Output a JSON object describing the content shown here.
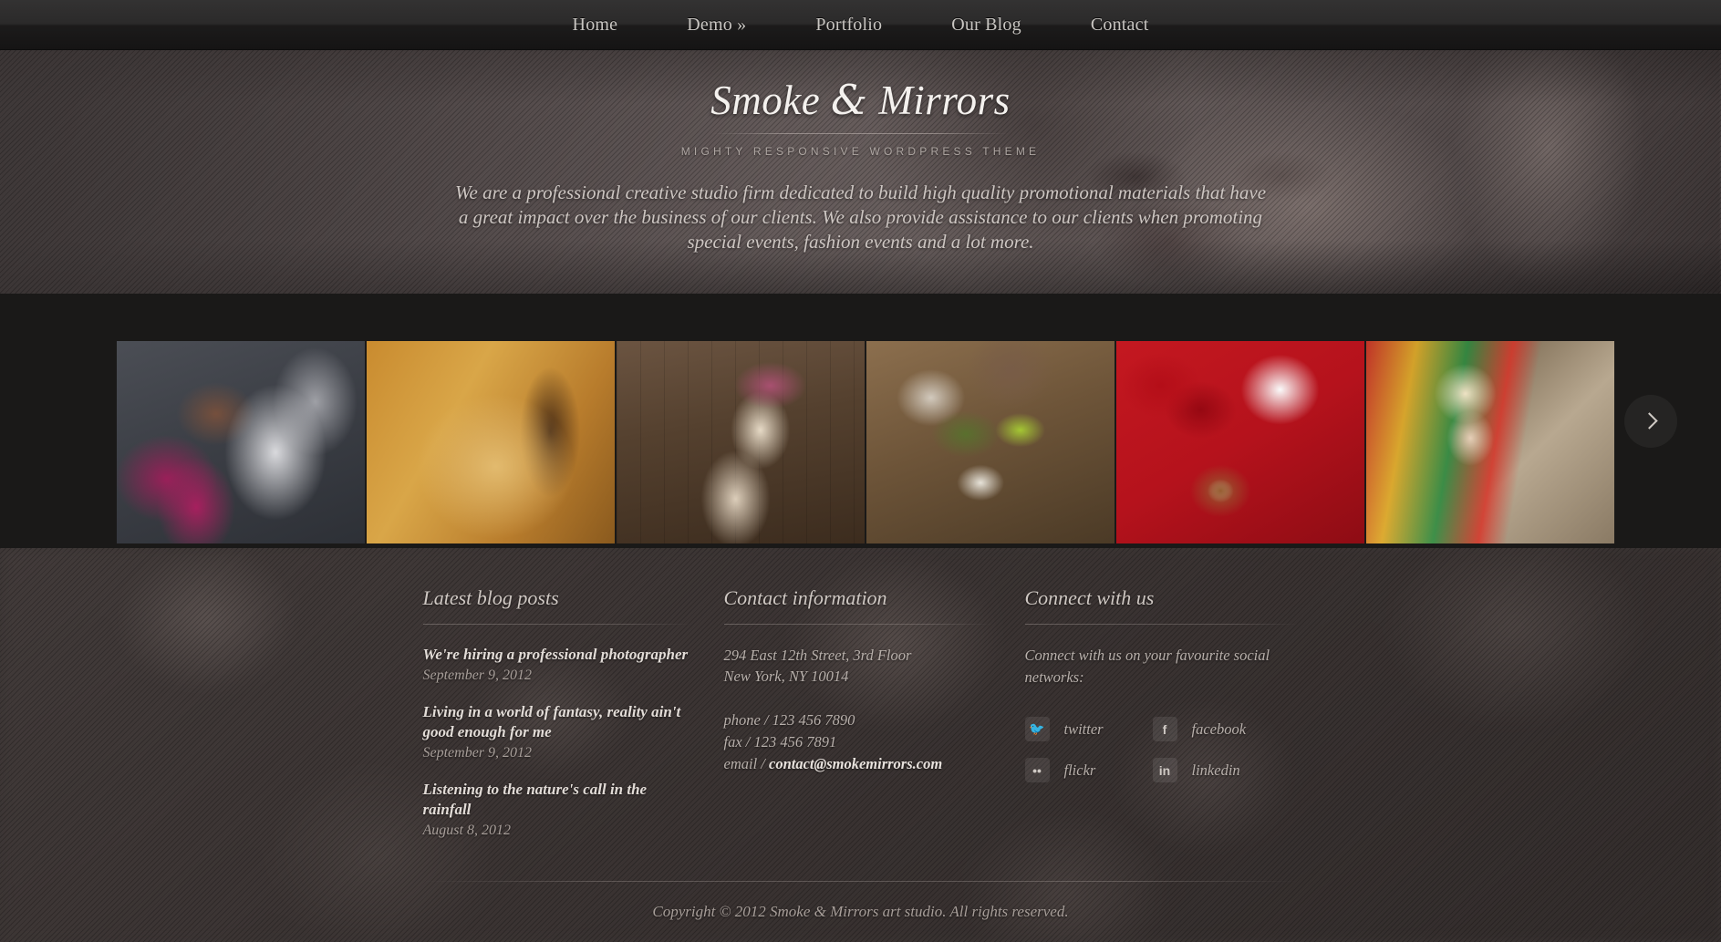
{
  "nav": {
    "items": [
      {
        "label": "Home",
        "name": "home"
      },
      {
        "label": "Demo »",
        "name": "demo"
      },
      {
        "label": "Portfolio",
        "name": "portfolio"
      },
      {
        "label": "Our Blog",
        "name": "blog"
      },
      {
        "label": "Contact",
        "name": "contact"
      }
    ]
  },
  "hero": {
    "title_part1": "Smoke ",
    "title_amp": "&",
    "title_part2": " Mirrors",
    "subtitle": "MIGHTY RESPONSIVE WORDPRESS THEME",
    "paragraph": "We are a professional creative studio firm dedicated to build high quality promotional materials that have a great impact over the business of our clients. We also provide assistance to our clients when promoting special events, fashion events and a lot more."
  },
  "gallery": {
    "next_label": "›",
    "items": [
      {
        "alt": "woman in magenta top with smoke",
        "class": "t1"
      },
      {
        "alt": "golden sundial close-up",
        "class": "t2"
      },
      {
        "alt": "blonde woman with pink hat and sunglasses on wood",
        "class": "t3"
      },
      {
        "alt": "spa still life with green bath salt",
        "class": "t4"
      },
      {
        "alt": "red roses with coffee cup and gingerbread heart",
        "class": "t5"
      },
      {
        "alt": "blonde woman with colourful halter top",
        "class": "t6"
      }
    ]
  },
  "footer": {
    "blog": {
      "heading": "Latest blog posts",
      "posts": [
        {
          "title": "We're hiring a professional photographer",
          "date": "September 9, 2012"
        },
        {
          "title": "Living in a world of fantasy, reality ain't good enough for me",
          "date": "September 9, 2012"
        },
        {
          "title": "Listening to the nature's call in the rainfall",
          "date": "August 8, 2012"
        }
      ]
    },
    "contact": {
      "heading": "Contact information",
      "address_line1": "294 East 12th Street, 3rd Floor",
      "address_line2": "New York, NY 10014",
      "phone": "phone / 123 456 7890",
      "fax": "fax / 123 456 7891",
      "email_label": "email / ",
      "email_value": "contact@smokemirrors.com"
    },
    "connect": {
      "heading": "Connect with us",
      "intro": "Connect with us on your favourite social networks:",
      "socials": [
        {
          "label": "twitter",
          "glyph": "🐦",
          "name": "twitter"
        },
        {
          "label": "facebook",
          "glyph": "f",
          "name": "facebook"
        },
        {
          "label": "flickr",
          "glyph": "••",
          "name": "flickr"
        },
        {
          "label": "linkedin",
          "glyph": "in",
          "name": "linkedin"
        }
      ]
    },
    "copyright": "Copyright © 2012 Smoke & Mirrors art studio. All rights reserved."
  },
  "colors": {
    "navbar_top": "#333232",
    "navbar_bottom": "#151414",
    "hero_base": "#6b6160",
    "gallery_bg": "#1a1918",
    "footer_bg": "#3b3534",
    "text_light": "#e2dcd7",
    "text_muted": "#a79e99"
  }
}
